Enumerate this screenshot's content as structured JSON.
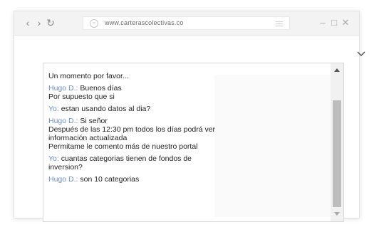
{
  "browser": {
    "url": "www.carterascolectivas.co",
    "icons": [
      "back-icon",
      "forward-icon",
      "reload-icon",
      "lock-icon",
      "menu-icon",
      "minimize-icon",
      "maximize-icon",
      "close-icon",
      "chevron-down-icon"
    ]
  },
  "chat": {
    "messages": [
      {
        "speaker": "",
        "text": "Un momento por favor..."
      },
      {
        "speaker": "Hugo D.:",
        "text": " Buenos días\nPor supuesto que si"
      },
      {
        "speaker": "Yo:",
        "text": " estan usando datos al dia?"
      },
      {
        "speaker": "Hugo D.:",
        "text": " Si señor\nDespués de las 12:30 pm todos los días podrá ver información actualizada\nPermitame le comento más de nuestro portal"
      },
      {
        "speaker": "Yo:",
        "text": " cuantas categorias tienen de fondos de inversion?"
      },
      {
        "speaker": "Hugo D.:",
        "text": " son 10 categorias"
      }
    ]
  },
  "colors": {
    "speaker": "#6d8bd3",
    "text": "#1f1f1f",
    "scroll_thumb": "#bdbdbd"
  }
}
